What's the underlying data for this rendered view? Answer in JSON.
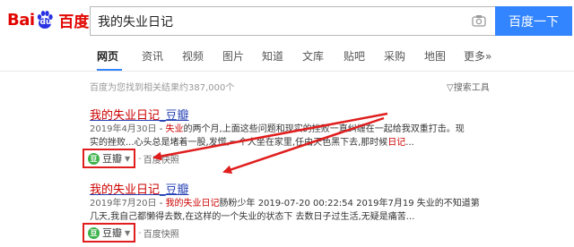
{
  "header": {
    "logo_bai": "Bai",
    "logo_du": "du",
    "logo_cn": "百度",
    "query": "我的失业日记",
    "search_button": "百度一下"
  },
  "tabs": [
    "网页",
    "资讯",
    "视频",
    "图片",
    "知道",
    "文库",
    "贴吧",
    "采购",
    "地图",
    "更多»"
  ],
  "stats": "百度为您找到相关结果约387,000个",
  "search_tools": "▽搜索工具",
  "results": [
    {
      "title_hl": "我的失业日记",
      "title_rest": "_豆瓣",
      "line1_date": "2019年4月30日",
      "line1_sep": " - ",
      "line1_hl": "失业",
      "line1_rest": "的两个月,上面这些问题和现实的挫败一直纠缠在一起给我双重打击。现",
      "line2_pre": "实的挫败...心头总是堵着一股,发慌,一个人坐在家里,任由天色黑下去,那时候",
      "line2_hl": "日记",
      "line2_post": "...",
      "source": "豆瓣",
      "cache": "百度快照"
    },
    {
      "title_hl": "我的失业日记",
      "title_rest": "_豆瓣",
      "line1_date": "2019年7月20日",
      "line1_sep": " - ",
      "line1_hl": "我的失业日记",
      "line1_rest": "肠粉少年 2019-07-20 00:22:54 2019年7月19 失业的不知道第",
      "line2_pre": "几天,我自己都懒得去数,在这样的一个失业的状态下 去数日子过生活,无疑是痛苦...",
      "line2_hl": "",
      "line2_post": "",
      "source": "豆瓣",
      "cache": "百度快照"
    }
  ],
  "colors": {
    "brand_red": "#e10601",
    "brand_blue": "#2932e1",
    "search_button": "#3385ff",
    "link": "#2440b3",
    "highlight": "#c00",
    "annotation": "#e01e1e",
    "douban_green": "#3db24a"
  }
}
